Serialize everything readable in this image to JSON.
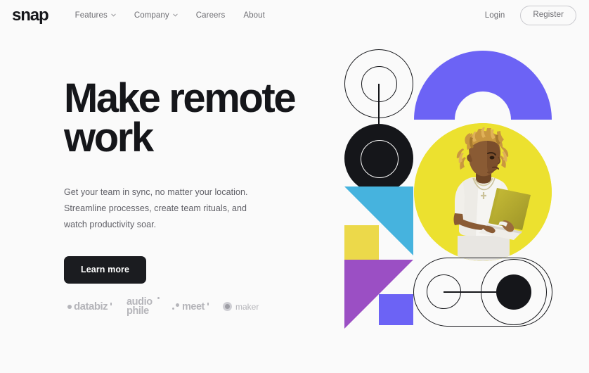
{
  "brand": {
    "name": "snap"
  },
  "nav": {
    "items": [
      {
        "label": "Features",
        "has_dropdown": true,
        "icon": "chevron-down-icon"
      },
      {
        "label": "Company",
        "has_dropdown": true,
        "icon": "chevron-down-icon"
      },
      {
        "label": "Careers",
        "has_dropdown": false
      },
      {
        "label": "About",
        "has_dropdown": false
      }
    ],
    "login_label": "Login",
    "register_label": "Register"
  },
  "hero": {
    "headline": "Make remote\nwork",
    "subcopy": "Get your team in sync, no matter your location.\nStreamline processes, create team rituals, and\nwatch productivity soar.",
    "cta_label": "Learn more"
  },
  "clients": {
    "logos": [
      {
        "name": "databiz",
        "text": "databiz",
        "icon": "dot-mark-icon"
      },
      {
        "name": "audiophile",
        "line1": "audio",
        "line2": "phile",
        "icon": "dot-mark-icon"
      },
      {
        "name": "meet",
        "text": "meet",
        "icon": "two-dots-icon"
      },
      {
        "name": "maker",
        "text": "maker",
        "icon": "swirl-mark-icon"
      }
    ]
  },
  "art": {
    "alt": "Person with blonde dreadlocks in a white t-shirt standing and working on a laptop, on a yellow circular background",
    "colors": {
      "background": "#FAFAFA",
      "ink": "#15161A",
      "purple": "#6C63F5",
      "violet": "#9B4FC4",
      "blue": "#46B3DE",
      "yellow_circle": "#ECE12F",
      "yellow_square": "#ECD94A",
      "muted_text": "#6E6E73",
      "logo_grey": "#B5B5BA"
    },
    "shapes": [
      {
        "name": "outline-circle-large",
        "type": "circle-outline"
      },
      {
        "name": "outline-circle-small",
        "type": "circle-outline"
      },
      {
        "name": "vertical-stem",
        "type": "line"
      },
      {
        "name": "black-donut",
        "type": "donut"
      },
      {
        "name": "purple-arch",
        "type": "arch"
      },
      {
        "name": "yellow-photo-circle",
        "type": "circle-fill"
      },
      {
        "name": "blue-triangle-block",
        "type": "triangle"
      },
      {
        "name": "yellow-square",
        "type": "square"
      },
      {
        "name": "violet-triangle",
        "type": "triangle"
      },
      {
        "name": "periwinkle-square",
        "type": "square"
      },
      {
        "name": "stadium-outline",
        "type": "stadium-outline"
      },
      {
        "name": "stadium-small-ring",
        "type": "circle-outline"
      },
      {
        "name": "stadium-large-ring",
        "type": "circle-outline"
      },
      {
        "name": "stadium-black-dot",
        "type": "circle-fill"
      },
      {
        "name": "stadium-connector-bar",
        "type": "line"
      }
    ]
  }
}
